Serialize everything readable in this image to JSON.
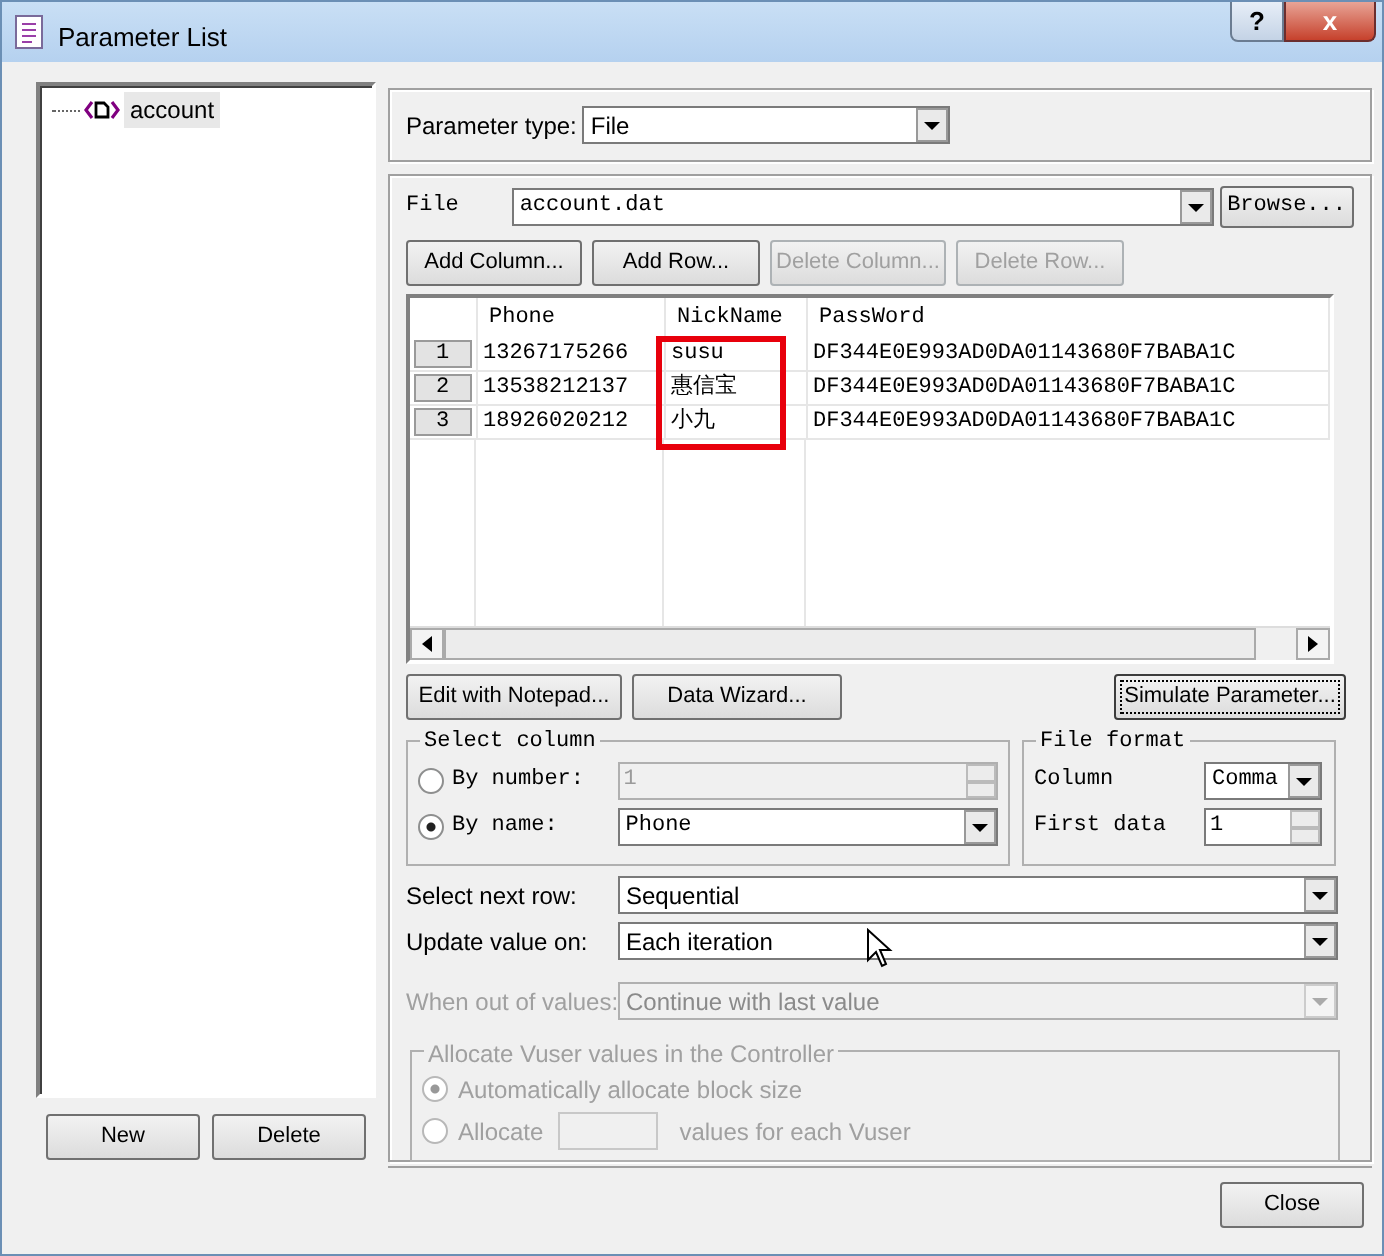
{
  "window": {
    "title": "Parameter List",
    "help": "?",
    "close": "x"
  },
  "tree": [
    {
      "label": "account",
      "selected": true
    }
  ],
  "tree_buttons": [
    "New",
    "Delete"
  ],
  "parameter_type": {
    "label": "Parameter type:",
    "value": "File"
  },
  "file": {
    "label": "File",
    "value": "account.dat",
    "browse": "Browse..."
  },
  "table_buttons": [
    {
      "label": "Add Column...",
      "disabled": false
    },
    {
      "label": "Add Row...",
      "disabled": false
    },
    {
      "label": "Delete Column...",
      "disabled": true
    },
    {
      "label": "Delete Row...",
      "disabled": true
    }
  ],
  "table": {
    "columns": [
      {
        "label": "Phone",
        "highlighted": false
      },
      {
        "label": "NickName",
        "highlighted": true
      },
      {
        "label": "PassWord",
        "highlighted": false
      }
    ],
    "rows": [
      {
        "number": "1",
        "cells": [
          "13267175266",
          "susu",
          "DF344E0E993AD0DA01143680F7BABA1C"
        ]
      },
      {
        "number": "2",
        "cells": [
          "13538212137",
          "惠信宝",
          "DF344E0E993AD0DA01143680F7BABA1C"
        ]
      },
      {
        "number": "3",
        "cells": [
          "18926020212",
          "小九",
          "DF344E0E993AD0DA01143680F7BABA1C"
        ]
      }
    ]
  },
  "data_buttons": [
    {
      "label": "Edit with Notepad...",
      "focused": false
    },
    {
      "label": "Data Wizard...",
      "focused": false
    },
    {
      "label": "Simulate Parameter...",
      "focused": true
    }
  ],
  "select_column": {
    "title": "Select column",
    "options": [
      {
        "label": "By number:",
        "selected": false,
        "kind": "spin",
        "value": "1",
        "disabled": true
      },
      {
        "label": "By name:",
        "selected": true,
        "kind": "dropdown",
        "value": "Phone",
        "disabled": false
      }
    ]
  },
  "file_format": {
    "title": "File format",
    "fields": [
      {
        "label": "Column",
        "kind": "dropdown",
        "value": "Comma"
      },
      {
        "label": "First data",
        "kind": "spin",
        "value": "1"
      }
    ]
  },
  "settings": [
    {
      "label": "Select next row:",
      "value": "Sequential",
      "disabled": false
    },
    {
      "label": "Update value on:",
      "value": "Each iteration",
      "disabled": false
    },
    {
      "label": "When out of values:",
      "value": "Continue with last value",
      "disabled": true
    }
  ],
  "allocate": {
    "title": "Allocate Vuser values in the Controller",
    "disabled": true,
    "options": [
      {
        "label": "Automatically allocate block size",
        "selected": true
      },
      {
        "label": "Allocate",
        "selected": false,
        "suffix": "values for each Vuser"
      }
    ]
  },
  "close_button": "Close"
}
